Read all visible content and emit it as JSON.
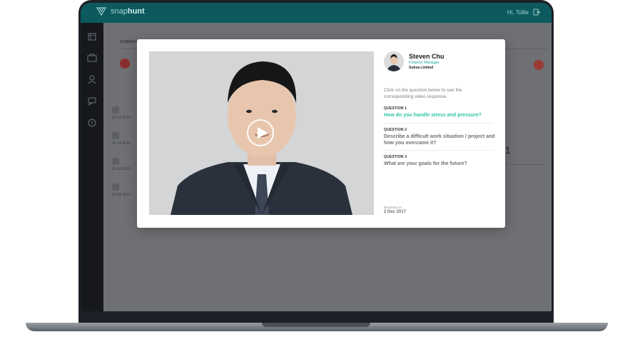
{
  "app": {
    "logo_prefix": "snap",
    "logo_suffix": "hunt",
    "greeting": "Hi, Tollie"
  },
  "background": {
    "tabs": [
      "SUMMARY"
    ],
    "dates": [
      "20 Jul 2018",
      "20 Jul 2018",
      "20 Jul 2018",
      "20 Jul 2018"
    ],
    "kpi_value": "1"
  },
  "modal": {
    "candidate": {
      "name": "Steven Chu",
      "role": "Finance Manager",
      "company": "Subsa Limited"
    },
    "instructions": "Click on the question below to see the corresponding video response.",
    "questions": [
      {
        "label": "QUESTION 1",
        "text": "How do you handle stress and pressure?",
        "active": true
      },
      {
        "label": "QUESTION 2",
        "text": "Describe a difficult work situation / project and how you overcame it?",
        "active": false
      },
      {
        "label": "QUESTION 3",
        "text": "What are your goals for the future?",
        "active": false
      }
    ],
    "received_label": "Received on",
    "received_date": "2 Dec 2017"
  },
  "colors": {
    "accent": "#2ec4a6",
    "topbar": "#0d5a5e",
    "sidebar": "#16181c"
  },
  "icons": [
    "logo-icon",
    "logout-icon",
    "list-icon",
    "briefcase-icon",
    "users-icon",
    "chat-icon",
    "info-icon",
    "play-icon"
  ]
}
